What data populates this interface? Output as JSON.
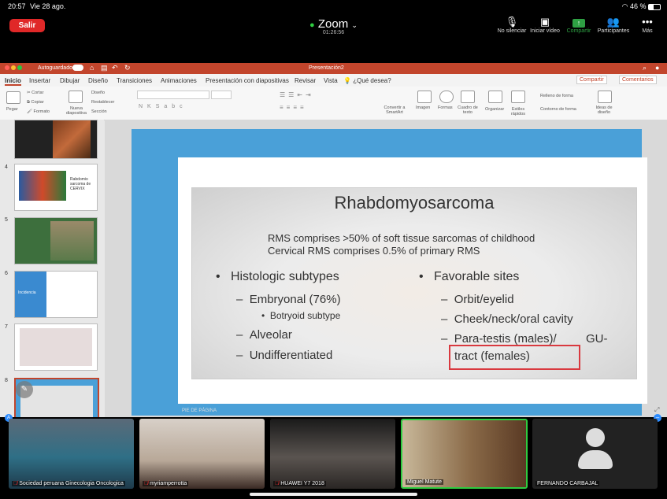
{
  "status_bar": {
    "time": "20:57",
    "date": "Vie 28 ago.",
    "battery": "46 %"
  },
  "zoom": {
    "leave_label": "Salir",
    "app_name": "Zoom",
    "timer": "01:26:56",
    "controls": [
      {
        "label": "No silenciar",
        "icon": "microphone-muted-icon"
      },
      {
        "label": "Iniciar vídeo",
        "icon": "video-off-icon"
      },
      {
        "label": "Compartir",
        "icon": "share-icon",
        "color": "#2ea043"
      },
      {
        "label": "Participantes",
        "icon": "participants-icon"
      },
      {
        "label": "Más",
        "icon": "more-icon"
      }
    ]
  },
  "powerpoint": {
    "autosave_label": "Autoguardado",
    "doc_title": "Presentación2",
    "tabs": [
      "Inicio",
      "Insertar",
      "Dibujar",
      "Diseño",
      "Transiciones",
      "Animaciones",
      "Presentación con diapositivas",
      "Revisar",
      "Vista",
      "¿Qué desea?"
    ],
    "share_button": "Compartir",
    "comments_button": "Comentarios",
    "ribbon": {
      "paste": "Pegar",
      "cut": "Cortar",
      "copy": "Copiar",
      "format": "Formato",
      "new_slide": "Nueva diapositiva",
      "layout": "Diseño",
      "reset": "Restablecer",
      "section": "Sección",
      "convert_smartart": "Convertir a SmartArt",
      "image": "Imagen",
      "shapes": "Formas",
      "text_box": "Cuadro de texto",
      "arrange": "Organizar",
      "quick_styles": "Estilos rápidos",
      "shape_fill": "Relleno de forma",
      "shape_outline": "Contorno de forma",
      "design_ideas": "Ideas de diseño"
    },
    "thumbnails": [
      "4",
      "5",
      "6",
      "7",
      "8"
    ],
    "thumb_texts": {
      "t4": "Rabdomio sarcoma de CERVIX",
      "t6": "Incidencia"
    },
    "footer": "PIE DE PÁGINA"
  },
  "slide": {
    "title": "Rhabdomyosarcoma",
    "stat_1": "RMS comprises >50% of soft tissue sarcomas of childhood",
    "stat_2": "Cervical RMS comprises 0.5% of primary RMS",
    "left_bullet": "Histologic subtypes",
    "left_items": [
      "Embryonal (76%)",
      "Alveolar",
      "Undifferentiated"
    ],
    "left_subitem": "Botryoid subtype",
    "right_bullet": "Favorable sites",
    "right_items": [
      "Orbit/eyelid",
      "Cheek/neck/oral cavity",
      "Para-testis (males)/",
      "GU-",
      "tract (females)"
    ]
  },
  "participants": [
    {
      "name": "Sociedad peruana Ginecologia Oncologica",
      "muted": true
    },
    {
      "name": "myriamperrotta",
      "muted": true
    },
    {
      "name": "HUAWEI Y7 2018",
      "muted": true
    },
    {
      "name": "Miguel Matute",
      "muted": false,
      "active": true
    },
    {
      "name": "FERNANDO CARBAJAL",
      "muted": false
    }
  ],
  "colors": {
    "leave": "#e02828",
    "ppt_title": "#c2452c",
    "slide_bg": "#4aa0d8",
    "active_speaker": "#2ecc40",
    "highlight": "#d9393f"
  }
}
